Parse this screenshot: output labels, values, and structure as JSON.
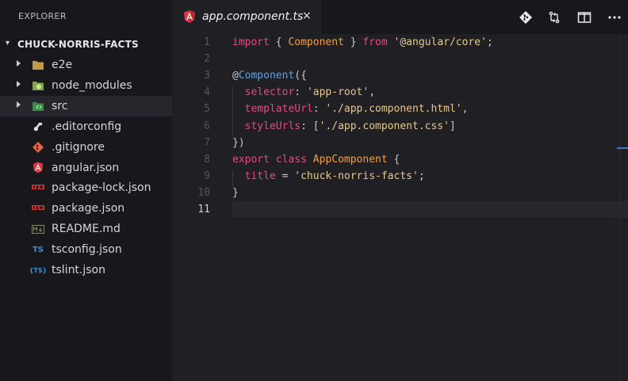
{
  "sidebar": {
    "title": "EXPLORER",
    "project": "CHUCK-NORRIS-FACTS",
    "items": [
      {
        "label": "e2e",
        "icon": "folder-icon",
        "type": "folder",
        "icon_glyph": "▬",
        "icon_color": "#c49a4a"
      },
      {
        "label": "node_modules",
        "icon": "node-folder-icon",
        "type": "folder",
        "icon_glyph": "⬢",
        "icon_color": "#8cc84b"
      },
      {
        "label": "src",
        "icon": "src-folder-icon",
        "type": "folder",
        "icon_glyph": "◆",
        "icon_color": "#4caf50"
      },
      {
        "label": ".editorconfig",
        "icon": "editorconfig-icon",
        "type": "file",
        "icon_glyph": "✎",
        "icon_color": "#e0e0e4"
      },
      {
        "label": ".gitignore",
        "icon": "git-icon",
        "type": "file",
        "icon_glyph": "◆",
        "icon_color": "#e0644a"
      },
      {
        "label": "angular.json",
        "icon": "angular-icon",
        "type": "file",
        "icon_glyph": "A",
        "icon_color": "#dd3844"
      },
      {
        "label": "package-lock.json",
        "icon": "npm-icon",
        "type": "file",
        "icon_glyph": "npm",
        "icon_color": "#c83232"
      },
      {
        "label": "package.json",
        "icon": "npm-icon",
        "type": "file",
        "icon_glyph": "npm",
        "icon_color": "#c83232"
      },
      {
        "label": "README.md",
        "icon": "markdown-icon",
        "type": "file",
        "icon_glyph": "M↓",
        "icon_color": "#8a8a6a"
      },
      {
        "label": "tsconfig.json",
        "icon": "tsconfig-icon",
        "type": "file",
        "icon_glyph": "TS",
        "icon_color": "#3d8fd8"
      },
      {
        "label": "tslint.json",
        "icon": "tslint-icon",
        "type": "file",
        "icon_glyph": "{TS}",
        "icon_color": "#3d8fd8"
      }
    ]
  },
  "tab": {
    "label": "app.component.ts",
    "close": "×",
    "icon": "angular-icon"
  },
  "toolbar": {
    "actions": [
      "git-icon",
      "compare-changes-icon",
      "split-editor-icon",
      "more-actions-icon"
    ]
  },
  "editor": {
    "line_numbers": [
      "1",
      "2",
      "3",
      "4",
      "5",
      "6",
      "7",
      "8",
      "9",
      "10",
      "11"
    ],
    "active_line": "11",
    "lines": [
      "import { Component } from '@angular/core';",
      "",
      "@Component({",
      "  selector: 'app-root',",
      "  templateUrl: './app.component.html',",
      "  styleUrls: ['./app.component.css']",
      "})",
      "export class AppComponent {",
      "  title = 'chuck-norris-facts';",
      "}",
      ""
    ]
  },
  "colors": {
    "keyword": "#e64a7c",
    "class": "#f0a04a",
    "string": "#e6c88a",
    "decorator": "#5fa0e6",
    "background": "#1f1f24",
    "sidebar": "#18181c"
  }
}
